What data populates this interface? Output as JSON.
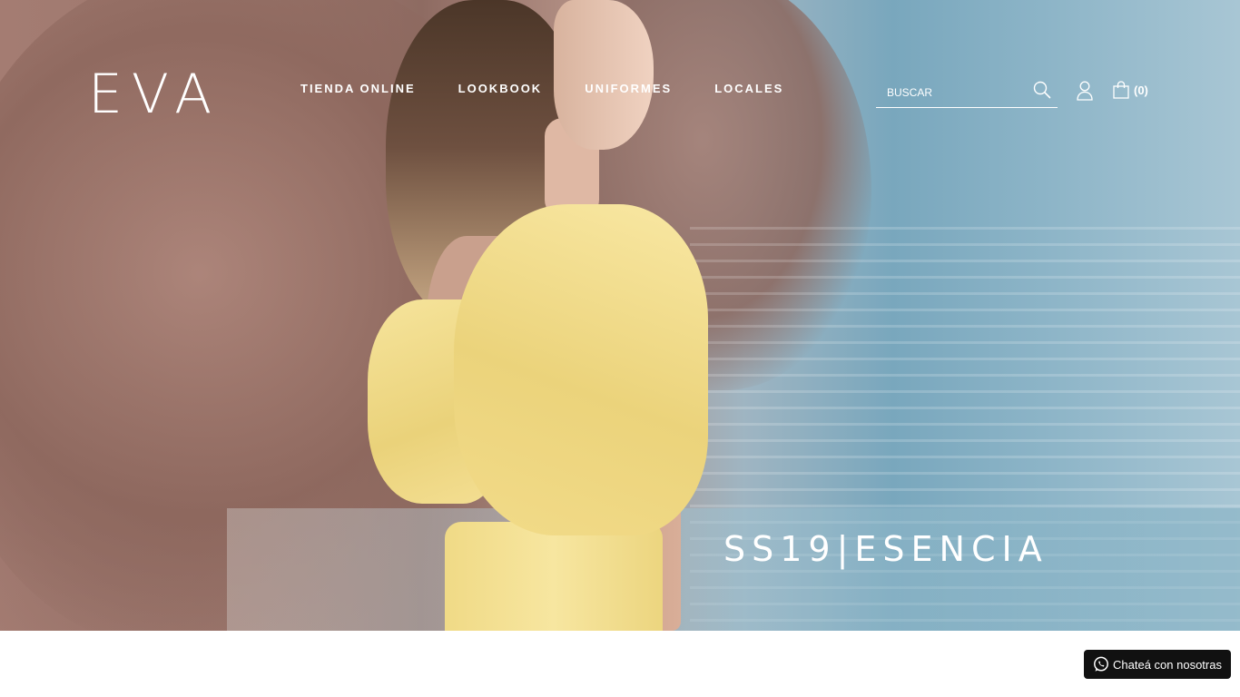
{
  "brand": {
    "logo_text": "EVA"
  },
  "nav": {
    "items": [
      {
        "label": "TIENDA ONLINE"
      },
      {
        "label": "LOOKBOOK"
      },
      {
        "label": "UNIFORMES"
      },
      {
        "label": "LOCALES"
      }
    ]
  },
  "search": {
    "placeholder": "BUSCAR",
    "icon": "search-icon"
  },
  "account": {
    "icon": "user-icon"
  },
  "cart": {
    "icon": "shopping-bag-icon",
    "count_label": "(0)"
  },
  "hero": {
    "caption": "SS19|ESENCIA"
  },
  "chat": {
    "label": "Chateá con nosotras",
    "icon": "whatsapp-icon"
  },
  "colors": {
    "header_text": "#ffffff",
    "chat_background": "#111111",
    "page_background": "#ffffff"
  }
}
